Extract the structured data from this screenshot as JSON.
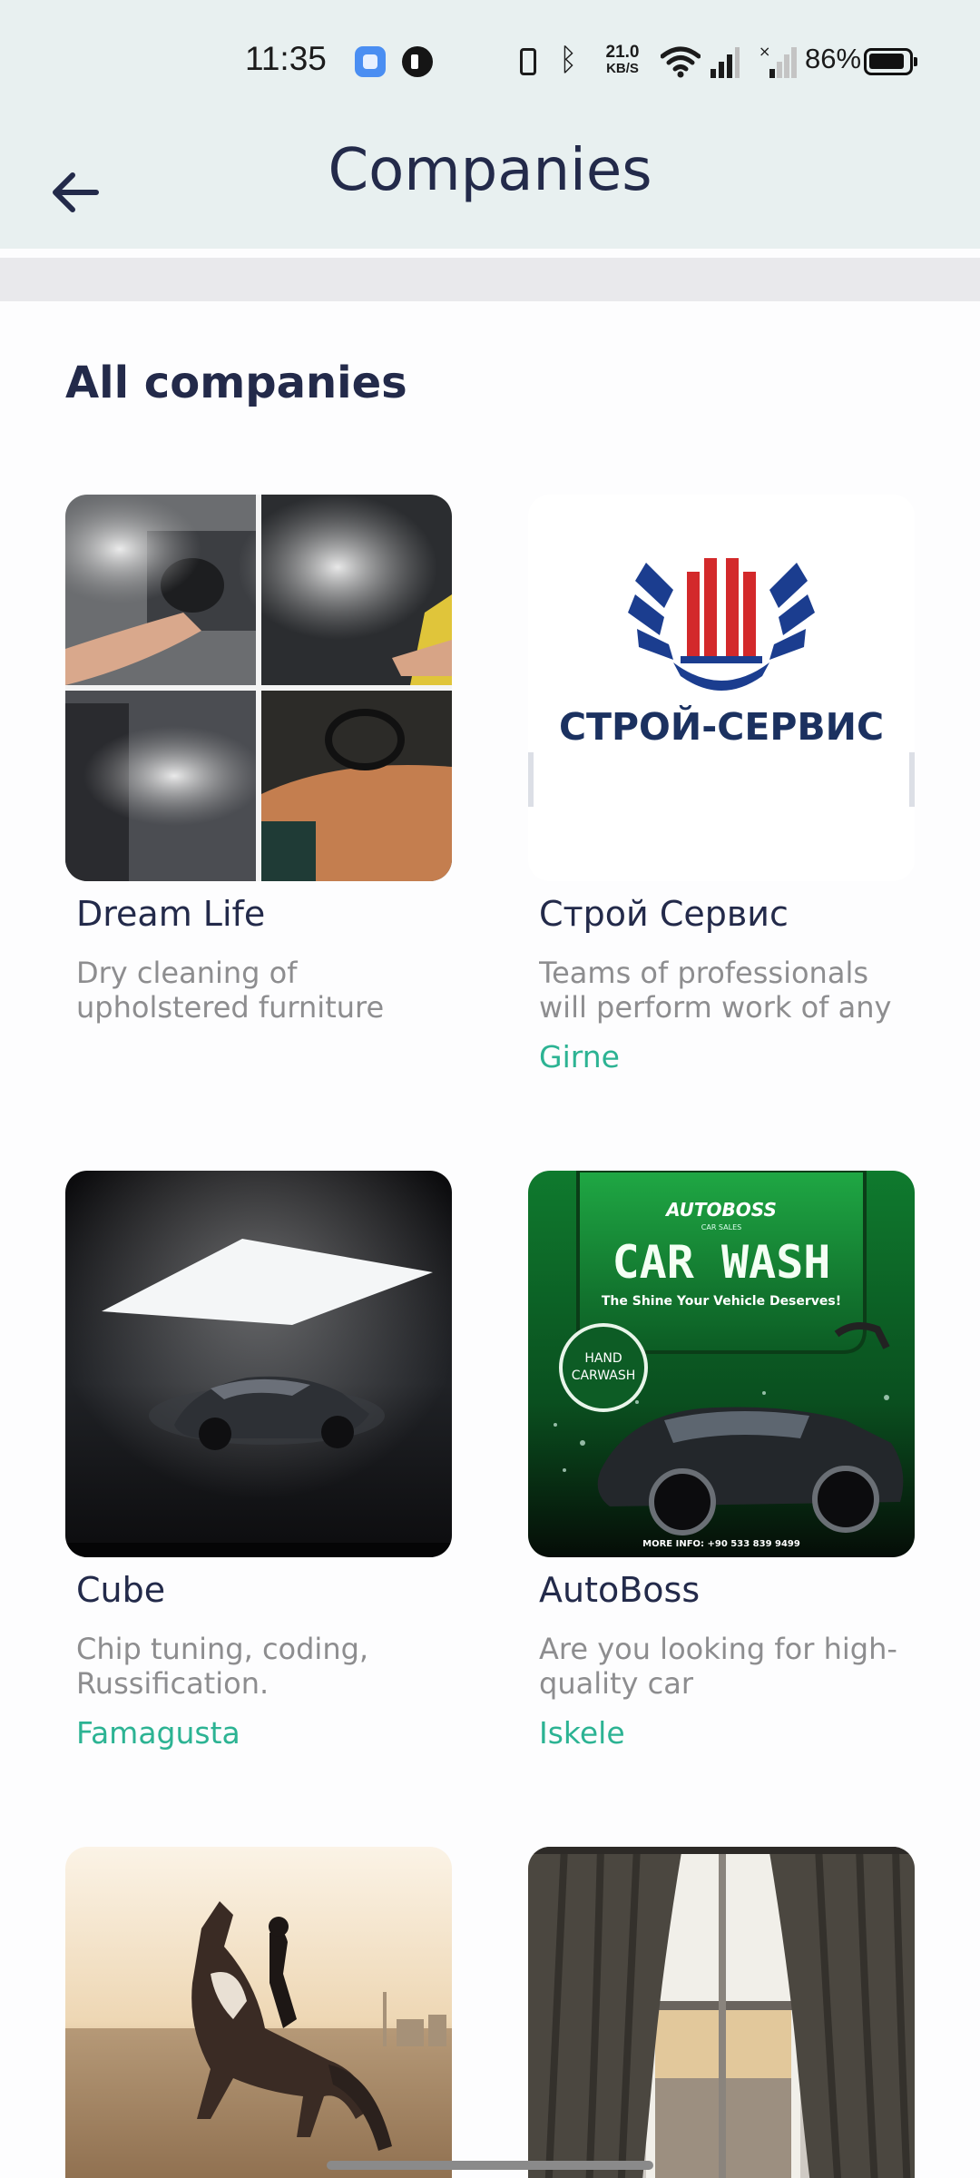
{
  "status_bar": {
    "time": "11:35",
    "net_speed_value": "21.0",
    "net_speed_unit": "KB/S",
    "battery": "86%",
    "icons": [
      "app-notification-icon",
      "app-notification-icon-2",
      "vibrate-icon",
      "bluetooth-icon",
      "wifi-icon",
      "signal-icon",
      "signal-no-service-icon",
      "battery-icon"
    ]
  },
  "header": {
    "title": "Companies",
    "back_icon": "arrow-left-icon"
  },
  "section": {
    "title": "All companies"
  },
  "companies": [
    {
      "name": "Dream Life",
      "description": "Dry cleaning of upholstered furniture",
      "city": ""
    },
    {
      "name": "Строй Сервис",
      "description": "Teams of professionals will perform work of any",
      "city": "Girne",
      "logo_text": "СТРОЙ-СЕРВИС"
    },
    {
      "name": "Cube",
      "description": "Chip tuning, coding, Russification.",
      "city": "Famagusta"
    },
    {
      "name": "AutoBoss",
      "description": "Are you looking for high-quality car",
      "city": "Iskele",
      "image_text": {
        "brand": "AUTOBOSS",
        "sub": "CAR SALES",
        "headline": "CAR WASH",
        "tagline": "The Shine Your Vehicle Deserves!",
        "badge1": "HAND",
        "badge2": "CARWASH",
        "footer": "MORE INFO: +90 533 839 9499"
      }
    },
    {
      "name": "",
      "description": "",
      "city": ""
    },
    {
      "name": "",
      "description": "",
      "city": ""
    }
  ],
  "colors": {
    "header_bg": "#e8f0f0",
    "title": "#232a4a",
    "description": "#8d8d8f",
    "city": "#2cb393"
  }
}
